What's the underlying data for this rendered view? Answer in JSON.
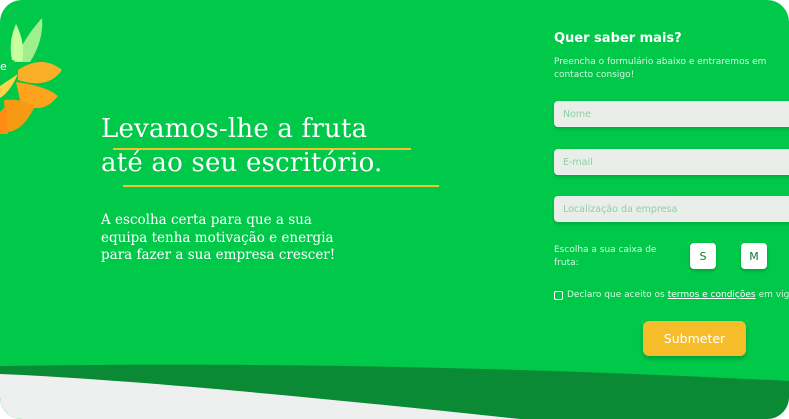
{
  "hero": {
    "title_line1": "Levamos-lhe a fruta",
    "title_line2": "até ao seu escritório.",
    "subtitle_line1": "A escolha certa para que a sua",
    "subtitle_line2": "equipa tenha motivação e energia",
    "subtitle_line3": "para fazer a sua empresa crescer!"
  },
  "form": {
    "title": "Quer saber mais?",
    "description": "Preencha o formulário abaixo e entraremos em contacto consigo!",
    "name_placeholder": "Nome",
    "email_placeholder": "E-mail",
    "location_placeholder": "Localização da empresa",
    "box_label": "Escolha a sua caixa de fruta:",
    "box_sizes": [
      "S",
      "M"
    ],
    "consent_prefix": "Declaro que aceito os",
    "consent_link": "termos e condições",
    "consent_suffix": "em vigor",
    "submit_label": "Submeter"
  },
  "colors": {
    "background_green": "#00c94a",
    "dark_green": "#0a8a34",
    "accent_yellow": "#f6bd2b",
    "underline_yellow": "#f2c230"
  },
  "icons": {
    "logo": "orange-slice-logo-icon"
  }
}
